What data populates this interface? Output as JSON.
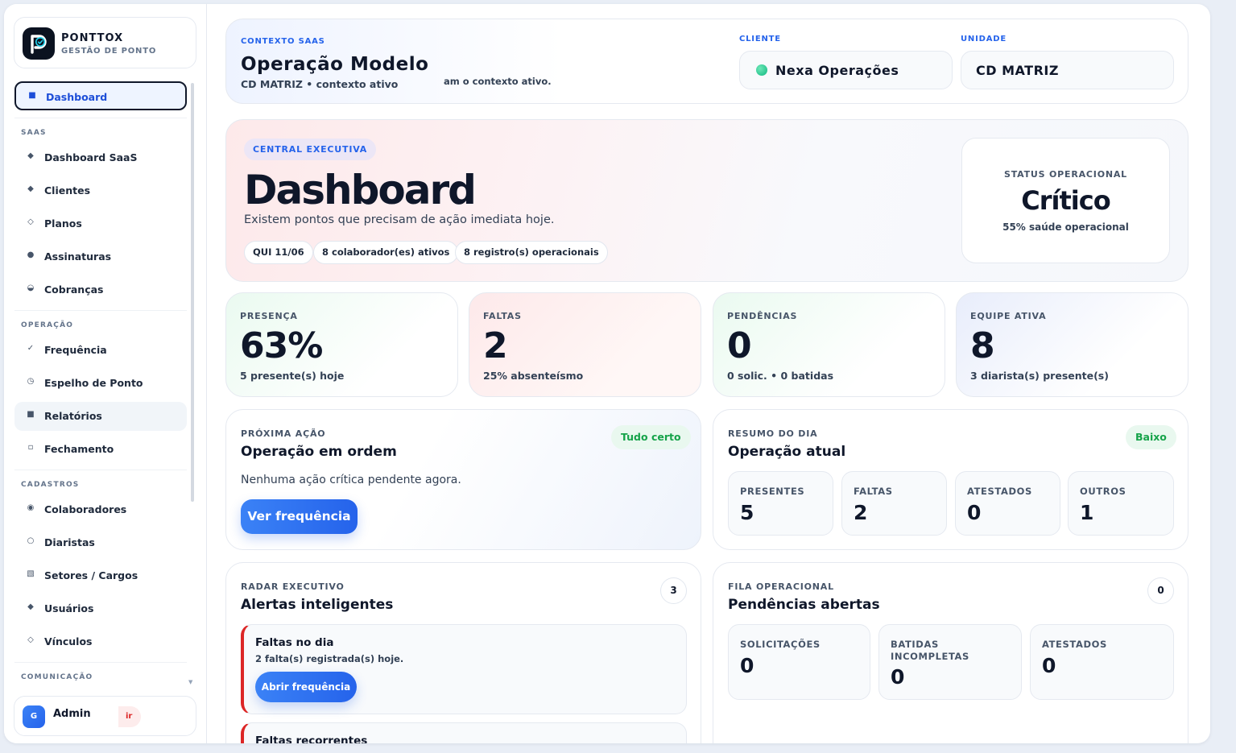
{
  "brand": {
    "name": "PONTTOX",
    "subtitle": "GESTÃO DE PONTO"
  },
  "sidebar": {
    "active": {
      "label": "Dashboard",
      "icon": "square-icon"
    },
    "sections": [
      {
        "title": "SAAS",
        "items": [
          {
            "label": "Dashboard SaaS",
            "icon": "diamond-icon"
          },
          {
            "label": "Clientes",
            "icon": "diamond-icon"
          },
          {
            "label": "Planos",
            "icon": "diamond-outline-icon"
          },
          {
            "label": "Assinaturas",
            "icon": "dot-icon"
          },
          {
            "label": "Cobranças",
            "icon": "half-circle-icon"
          }
        ]
      },
      {
        "title": "OPERAÇÃO",
        "items": [
          {
            "label": "Frequência",
            "icon": "check-icon"
          },
          {
            "label": "Espelho de Ponto",
            "icon": "clock-icon"
          },
          {
            "label": "Relatórios",
            "icon": "square-icon"
          },
          {
            "label": "Fechamento",
            "icon": "square-outline-icon"
          }
        ]
      },
      {
        "title": "CADASTROS",
        "items": [
          {
            "label": "Colaboradores",
            "icon": "dot-ring-icon"
          },
          {
            "label": "Diaristas",
            "icon": "circle-outline-icon"
          },
          {
            "label": "Setores / Cargos",
            "icon": "grid-icon"
          },
          {
            "label": "Usuários",
            "icon": "diamond-icon"
          },
          {
            "label": "Vínculos",
            "icon": "diamond-outline-icon"
          }
        ]
      },
      {
        "title": "COMUNICAÇÃO",
        "items": []
      }
    ],
    "user": {
      "initial": "G",
      "name": "Admin",
      "logout_fragment": "ir"
    }
  },
  "context": {
    "eyebrow": "CONTEXTO SAAS",
    "title": "Operação Modelo",
    "subtitle": "CD MATRIZ • contexto ativo",
    "ghost_text": "am o contexto ativo.",
    "client_label": "CLIENTE",
    "client_value": "Nexa Operações",
    "unit_label": "UNIDADE",
    "unit_value": "CD MATRIZ"
  },
  "hero": {
    "eyebrow": "CENTRAL EXECUTIVA",
    "title": "Dashboard",
    "subtitle": "Existem pontos que precisam de ação imediata hoje.",
    "chips": [
      "QUI 11/06",
      "8 colaborador(es) ativos",
      "8 registro(s) operacionais"
    ],
    "status_label": "STATUS OPERACIONAL",
    "status_value": "Crítico",
    "status_note": "55% saúde operacional"
  },
  "kpis": [
    {
      "label": "PRESENÇA",
      "value": "63%",
      "note": "5 presente(s) hoje"
    },
    {
      "label": "FALTAS",
      "value": "2",
      "note": "25% absenteísmo"
    },
    {
      "label": "PENDÊNCIAS",
      "value": "0",
      "note": "0 solic. • 0 batidas"
    },
    {
      "label": "EQUIPE ATIVA",
      "value": "8",
      "note": "3 diarista(s) presente(s)"
    }
  ],
  "next_action": {
    "eyebrow": "PRÓXIMA AÇÃO",
    "title": "Operação em ordem",
    "badge": "Tudo certo",
    "text": "Nenhuma ação crítica pendente agora.",
    "button": "Ver frequência"
  },
  "day_summary": {
    "eyebrow": "RESUMO DO DIA",
    "title": "Operação atual",
    "badge": "Baixo",
    "stats": [
      {
        "label": "PRESENTES",
        "value": "5"
      },
      {
        "label": "FALTAS",
        "value": "2"
      },
      {
        "label": "ATESTADOS",
        "value": "0"
      },
      {
        "label": "OUTROS",
        "value": "1"
      }
    ]
  },
  "radar": {
    "eyebrow": "RADAR EXECUTIVO",
    "title": "Alertas inteligentes",
    "count": "3",
    "alerts": [
      {
        "title": "Faltas no dia",
        "desc": "2 falta(s) registrada(s) hoje.",
        "button": "Abrir frequência"
      },
      {
        "title": "Faltas recorrentes",
        "desc": ""
      }
    ]
  },
  "queue": {
    "eyebrow": "FILA OPERACIONAL",
    "title": "Pendências abertas",
    "count": "0",
    "stats": [
      {
        "label": "SOLICITAÇÕES",
        "value": "0"
      },
      {
        "label": "BATIDAS INCOMPLETAS",
        "value": "0"
      },
      {
        "label": "ATESTADOS",
        "value": "0"
      }
    ]
  },
  "colors": {
    "accent": "#2563eb",
    "danger": "#dc2626",
    "success": "#16a34a",
    "dark": "#0f172a"
  }
}
